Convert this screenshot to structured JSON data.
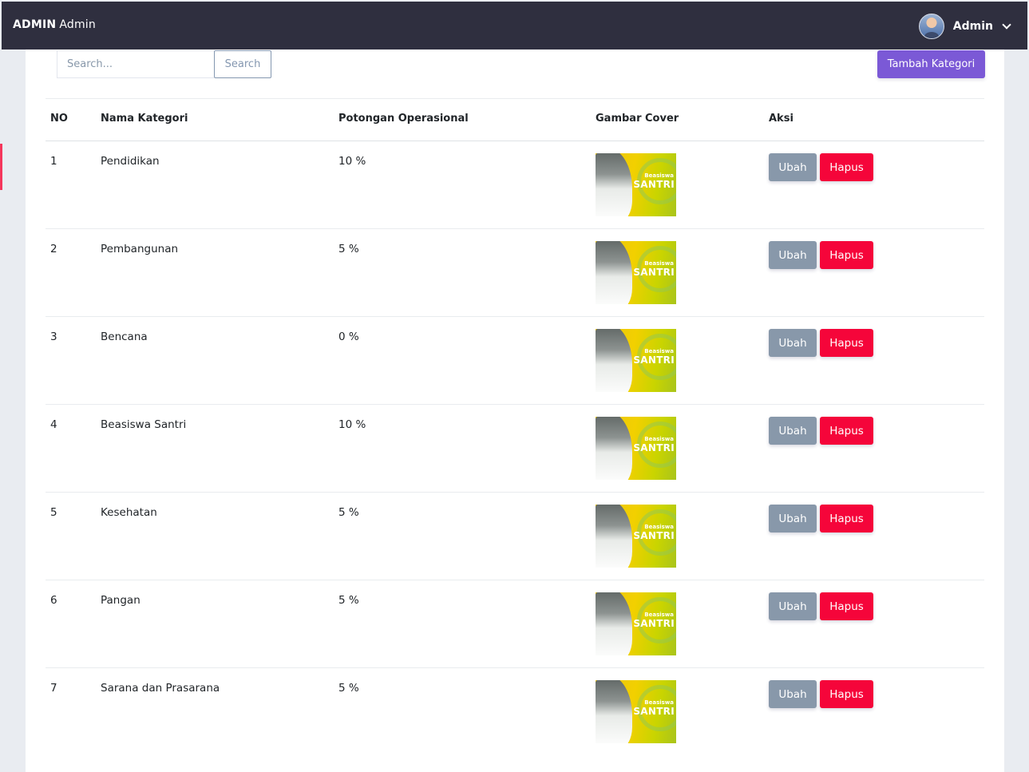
{
  "navbar": {
    "brand_bold": "ADMIN",
    "brand_text": "Admin",
    "user_name": "Admin"
  },
  "toolbar": {
    "search_placeholder": "Search...",
    "search_label": "Search",
    "add_label": "Tambah Kategori"
  },
  "table": {
    "headers": [
      "NO",
      "Nama Kategori",
      "Potongan Operasional",
      "Gambar Cover",
      "Aksi"
    ],
    "cover_text_small": "Beasiswa",
    "cover_text_large": "SANTRI",
    "rows": [
      {
        "no": "1",
        "name": "Pendidikan",
        "cut": "10 %"
      },
      {
        "no": "2",
        "name": "Pembangunan",
        "cut": "5 %"
      },
      {
        "no": "3",
        "name": "Bencana",
        "cut": "0 %"
      },
      {
        "no": "4",
        "name": "Beasiswa Santri",
        "cut": "10 %"
      },
      {
        "no": "5",
        "name": "Kesehatan",
        "cut": "5 %"
      },
      {
        "no": "6",
        "name": "Pangan",
        "cut": "5 %"
      },
      {
        "no": "7",
        "name": "Sarana dan Prasarana",
        "cut": "5 %"
      }
    ],
    "edit_label": "Ubah",
    "delete_label": "Hapus"
  },
  "colors": {
    "navbar": "#2f2f3f",
    "primary": "#7b59d6",
    "danger": "#f5053a",
    "secondary": "#8898aa"
  }
}
